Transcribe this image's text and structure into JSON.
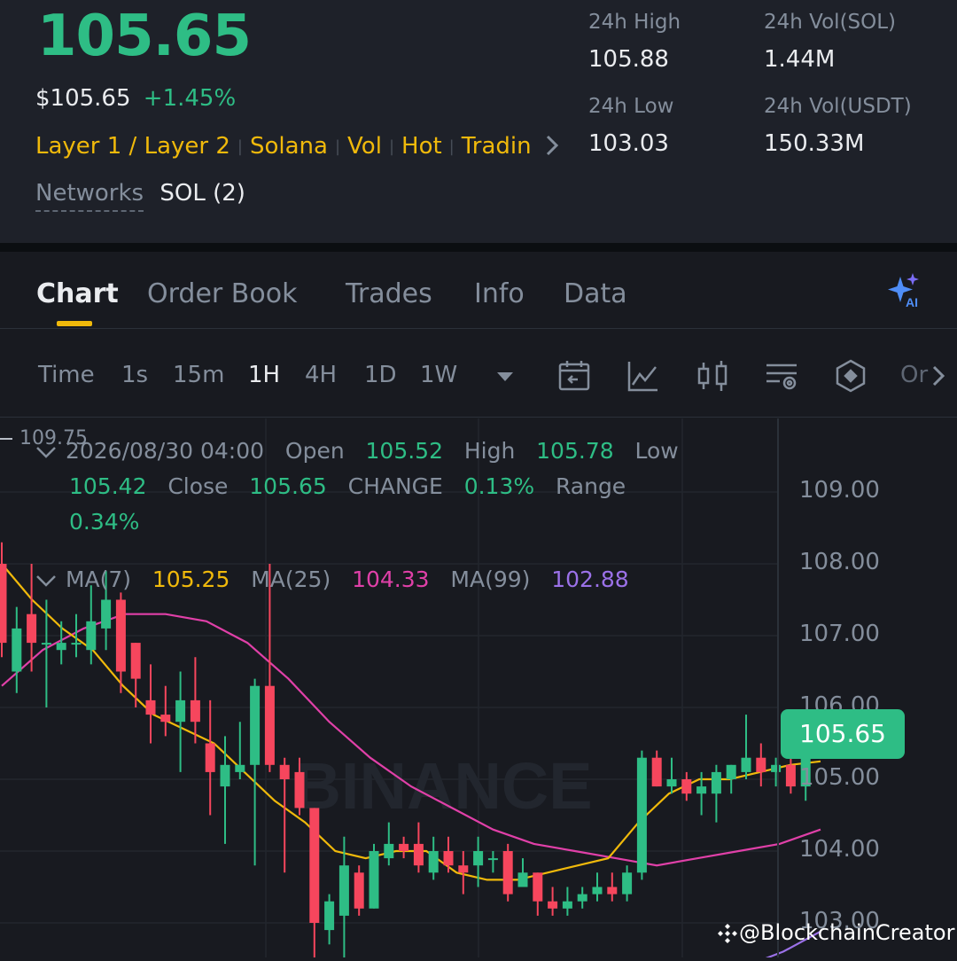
{
  "ticker": {
    "price": "105.65",
    "usd_price": "$105.65",
    "change_pct": "+1.45%",
    "tags": [
      "Layer 1 / Layer 2",
      "Solana",
      "Vol",
      "Hot",
      "Tradin"
    ],
    "networks_label": "Networks",
    "networks_value": "SOL (2)",
    "stats": {
      "high_label": "24h High",
      "high": "105.88",
      "low_label": "24h Low",
      "low": "103.03",
      "vol_sol_label": "24h Vol(SOL)",
      "vol_sol": "1.44M",
      "vol_usdt_label": "24h Vol(USDT)",
      "vol_usdt": "150.33M"
    }
  },
  "tabs": [
    "Chart",
    "Order Book",
    "Trades",
    "Info",
    "Data"
  ],
  "active_tab": "Chart",
  "timeframes": [
    "Time",
    "1s",
    "15m",
    "1H",
    "4H",
    "1D",
    "1W"
  ],
  "selected_timeframe": "1H",
  "toolbar_overflow_label": "Or",
  "ohlc": {
    "datetime": "2026/08/30 04:00",
    "open_label": "Open",
    "open": "105.52",
    "high_label": "High",
    "high": "105.78",
    "low_label": "Low",
    "low": "105.42",
    "close_label": "Close",
    "close": "105.65",
    "change_label": "CHANGE",
    "change": "0.13%",
    "range_label": "Range",
    "range": "0.34%"
  },
  "ma": {
    "ma7_label": "MA(7)",
    "ma7": "105.25",
    "ma25_label": "MA(25)",
    "ma25": "104.33",
    "ma99_label": "MA(99)",
    "ma99": "102.88"
  },
  "colors": {
    "up": "#2ebd85",
    "down": "#f6465d",
    "ma7": "#f0b90b",
    "ma25": "#e040a8",
    "ma99": "#9b71e8",
    "accent": "#f0b90b"
  },
  "chart_data": {
    "type": "candlestick",
    "y_ticks": [
      "109.00",
      "108.00",
      "107.00",
      "106.00",
      "105.00",
      "104.00",
      "103.00"
    ],
    "y_range": [
      102.5,
      109.75
    ],
    "top_marker": "109.75",
    "last_price": "105.65",
    "watermark": "BINANCE",
    "candles": [
      {
        "o": 108.0,
        "h": 108.3,
        "l": 106.7,
        "c": 106.9
      },
      {
        "o": 106.5,
        "h": 107.4,
        "l": 106.2,
        "c": 107.1
      },
      {
        "o": 107.3,
        "h": 108.0,
        "l": 106.5,
        "c": 106.9
      },
      {
        "o": 106.9,
        "h": 107.5,
        "l": 106.0,
        "c": 106.9
      },
      {
        "o": 106.8,
        "h": 107.2,
        "l": 106.6,
        "c": 106.9
      },
      {
        "o": 106.9,
        "h": 107.3,
        "l": 106.7,
        "c": 106.9
      },
      {
        "o": 106.8,
        "h": 107.7,
        "l": 106.6,
        "c": 107.2
      },
      {
        "o": 107.1,
        "h": 107.9,
        "l": 106.8,
        "c": 107.5
      },
      {
        "o": 107.5,
        "h": 107.6,
        "l": 106.2,
        "c": 106.5
      },
      {
        "o": 106.9,
        "h": 106.9,
        "l": 106.0,
        "c": 106.4
      },
      {
        "o": 106.1,
        "h": 106.6,
        "l": 105.5,
        "c": 105.9
      },
      {
        "o": 105.9,
        "h": 106.3,
        "l": 105.6,
        "c": 105.8
      },
      {
        "o": 105.8,
        "h": 106.5,
        "l": 105.1,
        "c": 106.1
      },
      {
        "o": 106.1,
        "h": 106.7,
        "l": 105.5,
        "c": 105.8
      },
      {
        "o": 105.5,
        "h": 106.1,
        "l": 104.5,
        "c": 105.1
      },
      {
        "o": 104.9,
        "h": 105.6,
        "l": 104.1,
        "c": 105.2
      },
      {
        "o": 105.1,
        "h": 105.8,
        "l": 105.0,
        "c": 105.2
      },
      {
        "o": 105.2,
        "h": 106.4,
        "l": 103.8,
        "c": 106.3
      },
      {
        "o": 106.3,
        "h": 108.0,
        "l": 105.1,
        "c": 105.2
      },
      {
        "o": 105.2,
        "h": 105.3,
        "l": 103.7,
        "c": 105.0
      },
      {
        "o": 105.1,
        "h": 105.3,
        "l": 104.5,
        "c": 104.6
      },
      {
        "o": 104.6,
        "h": 104.6,
        "l": 102.2,
        "c": 103.0
      },
      {
        "o": 102.9,
        "h": 103.4,
        "l": 102.7,
        "c": 103.3
      },
      {
        "o": 103.1,
        "h": 104.2,
        "l": 102.4,
        "c": 103.8
      },
      {
        "o": 103.7,
        "h": 103.8,
        "l": 103.1,
        "c": 103.2
      },
      {
        "o": 103.2,
        "h": 104.1,
        "l": 103.2,
        "c": 104.0
      },
      {
        "o": 103.9,
        "h": 104.4,
        "l": 103.8,
        "c": 104.1
      },
      {
        "o": 104.1,
        "h": 104.2,
        "l": 103.9,
        "c": 104.0
      },
      {
        "o": 104.1,
        "h": 104.4,
        "l": 103.7,
        "c": 103.8
      },
      {
        "o": 103.7,
        "h": 104.2,
        "l": 103.6,
        "c": 104.0
      },
      {
        "o": 104.0,
        "h": 104.2,
        "l": 103.7,
        "c": 103.8
      },
      {
        "o": 103.8,
        "h": 104.0,
        "l": 103.4,
        "c": 103.7
      },
      {
        "o": 103.8,
        "h": 104.2,
        "l": 103.5,
        "c": 104.0
      },
      {
        "o": 103.9,
        "h": 104.0,
        "l": 103.7,
        "c": 103.9
      },
      {
        "o": 104.0,
        "h": 104.1,
        "l": 103.3,
        "c": 103.4
      },
      {
        "o": 103.5,
        "h": 103.9,
        "l": 103.5,
        "c": 103.7
      },
      {
        "o": 103.7,
        "h": 103.7,
        "l": 103.1,
        "c": 103.3
      },
      {
        "o": 103.3,
        "h": 103.5,
        "l": 103.1,
        "c": 103.2
      },
      {
        "o": 103.2,
        "h": 103.5,
        "l": 103.1,
        "c": 103.3
      },
      {
        "o": 103.3,
        "h": 103.5,
        "l": 103.2,
        "c": 103.4
      },
      {
        "o": 103.4,
        "h": 103.7,
        "l": 103.3,
        "c": 103.5
      },
      {
        "o": 103.5,
        "h": 103.7,
        "l": 103.3,
        "c": 103.4
      },
      {
        "o": 103.4,
        "h": 103.8,
        "l": 103.3,
        "c": 103.7
      },
      {
        "o": 103.7,
        "h": 105.4,
        "l": 103.6,
        "c": 105.3
      },
      {
        "o": 105.3,
        "h": 105.4,
        "l": 104.9,
        "c": 104.9
      },
      {
        "o": 104.9,
        "h": 105.3,
        "l": 104.8,
        "c": 105.0
      },
      {
        "o": 105.0,
        "h": 105.1,
        "l": 104.7,
        "c": 104.8
      },
      {
        "o": 104.8,
        "h": 105.1,
        "l": 104.5,
        "c": 104.9
      },
      {
        "o": 104.8,
        "h": 105.2,
        "l": 104.4,
        "c": 105.1
      },
      {
        "o": 105.0,
        "h": 105.2,
        "l": 104.8,
        "c": 105.2
      },
      {
        "o": 105.1,
        "h": 105.9,
        "l": 105.0,
        "c": 105.3
      },
      {
        "o": 105.3,
        "h": 105.5,
        "l": 104.9,
        "c": 105.1
      },
      {
        "o": 105.1,
        "h": 105.3,
        "l": 104.9,
        "c": 105.2
      },
      {
        "o": 105.2,
        "h": 105.3,
        "l": 104.8,
        "c": 104.9
      },
      {
        "o": 104.9,
        "h": 105.5,
        "l": 104.7,
        "c": 105.4
      },
      {
        "o": 105.52,
        "h": 105.78,
        "l": 105.42,
        "c": 105.65
      }
    ],
    "ma7": [
      108.0,
      107.5,
      107.1,
      106.8,
      106.3,
      105.9,
      105.7,
      105.5,
      105.1,
      104.7,
      104.4,
      104.0,
      103.9,
      104.0,
      104.0,
      103.7,
      103.6,
      103.6,
      103.7,
      103.8,
      103.9,
      104.4,
      104.8,
      105.0,
      105.0,
      105.1,
      105.2,
      105.25
    ],
    "ma25": [
      106.3,
      106.8,
      107.1,
      107.3,
      107.3,
      107.2,
      106.9,
      106.4,
      105.8,
      105.3,
      104.9,
      104.6,
      104.3,
      104.1,
      104.0,
      103.9,
      103.8,
      103.9,
      104.0,
      104.1,
      104.3
    ],
    "ma99": [
      102.4,
      102.6,
      102.88
    ]
  }
}
